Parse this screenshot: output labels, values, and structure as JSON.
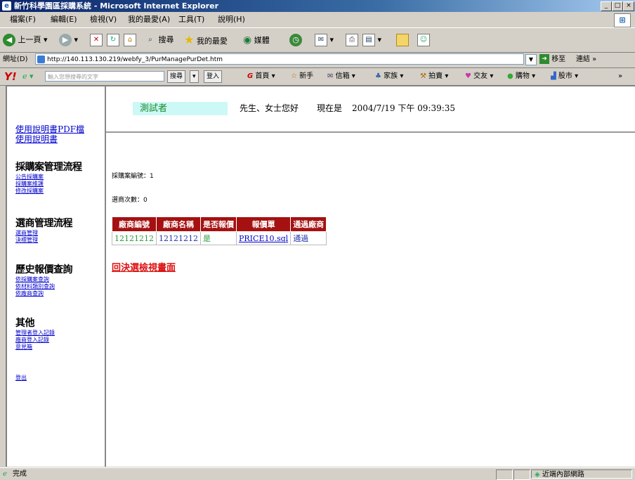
{
  "window": {
    "title": "新竹科學園區採購系統 - Microsoft Internet Explorer",
    "min_label": "_",
    "max_label": "□",
    "close_label": "×"
  },
  "menu": [
    "檔案(F)",
    "編輯(E)",
    "檢視(V)",
    "我的最愛(A)",
    "工具(T)",
    "說明(H)"
  ],
  "toolbar": {
    "back_label": "上一頁",
    "search_label": "搜尋",
    "favorites_label": "我的最愛",
    "media_label": "媒體"
  },
  "address": {
    "label": "網址(D)",
    "url": "http://140.113.130.219/webfy_3/PurManagePurDet.htm",
    "go_label": "移至",
    "links_label": "連結"
  },
  "yahoo_bar": {
    "search_placeholder": "輸入您想搜尋的文字",
    "search_button": "搜尋",
    "login_button": "登入",
    "items": [
      "首頁",
      "新手",
      "信箱",
      "家族",
      "拍賣",
      "交友",
      "購物",
      "股市"
    ]
  },
  "sidebar": {
    "manual_links": [
      "使用說明書PDF檔",
      "使用說明書"
    ],
    "sections": [
      {
        "title": "採購案管理流程",
        "links": [
          "公告採購案",
          "採購案維護",
          "修改採購案"
        ]
      },
      {
        "title": "選商管理流程",
        "links": [
          "選商管理",
          "決標管理"
        ]
      },
      {
        "title": "歷史報價查詢",
        "links": [
          "依採購案查詢",
          "依材料類別查詢",
          "依廠商查詢"
        ]
      },
      {
        "title": "其他",
        "links": [
          "管理者登入記錄",
          "廠商登入記錄",
          "意見箱"
        ]
      }
    ],
    "logout": "登出"
  },
  "header": {
    "user_name": "測試者",
    "greeting": "先生、女士您好",
    "now_label": "現在是",
    "datetime": "2004/7/19 下午 09:39:35"
  },
  "main": {
    "purchase_no_label": "採購案編號：1",
    "vendor_count_label": "選商次數：0",
    "table": {
      "headers": [
        "廠商編號",
        "廠商名稱",
        "是否報價",
        "報價單",
        "通過廠商"
      ],
      "rows": [
        [
          "12121212",
          "12121212",
          "是",
          "PRICE10.sql",
          "通過"
        ]
      ]
    },
    "back_link": "回決選檢視畫面"
  },
  "status": {
    "text": "完成",
    "zone": "近端內部網路"
  },
  "colors": {
    "header_bg": "#a51111",
    "user_box_bg": "#ccf9f5",
    "user_text": "#1a8a2a",
    "back_link": "#dd1111"
  }
}
